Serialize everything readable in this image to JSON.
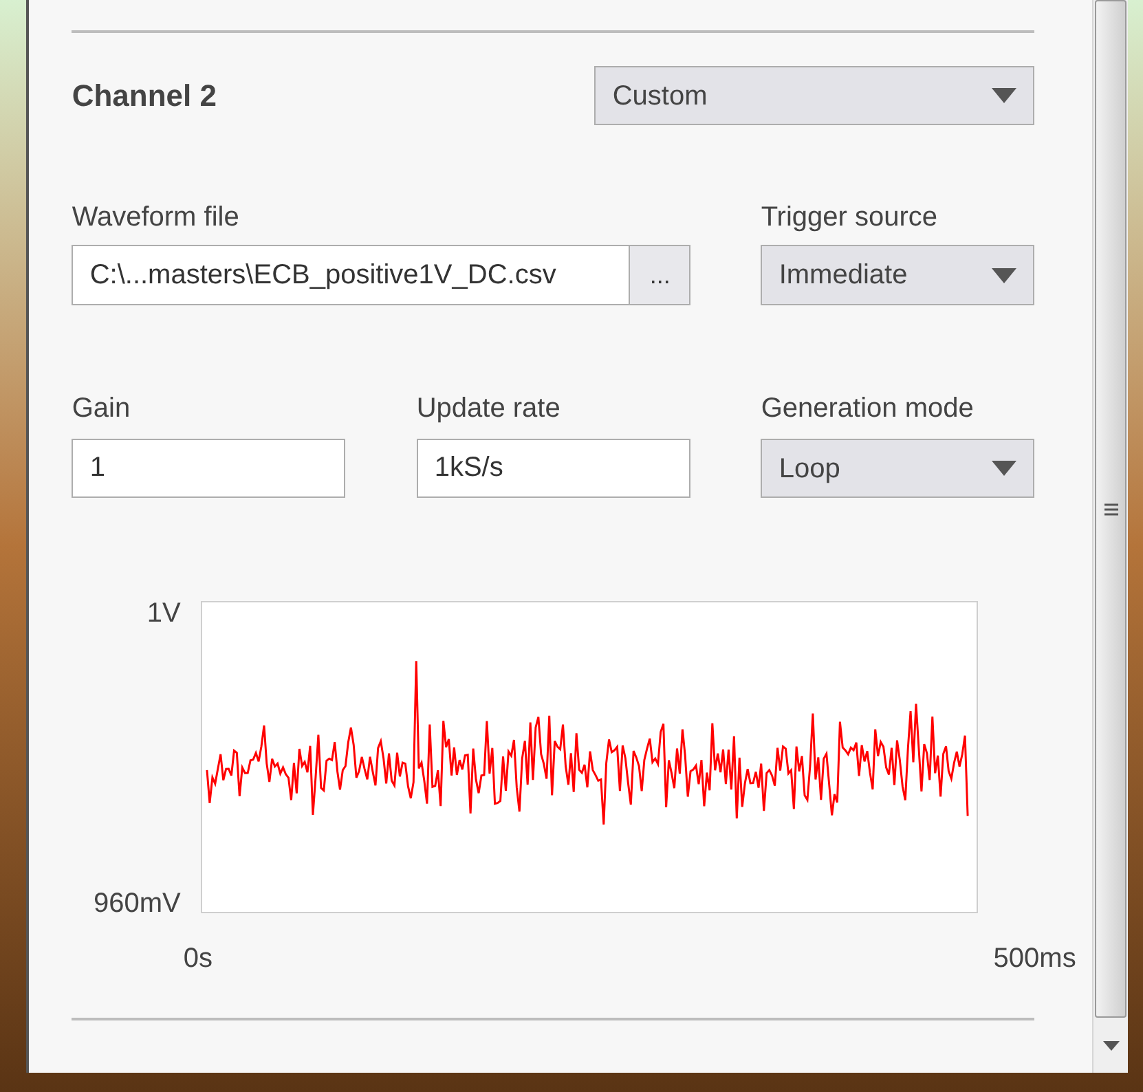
{
  "channel": {
    "title": "Channel 2",
    "preset": "Custom"
  },
  "waveform_file": {
    "label": "Waveform file",
    "value": "C:\\...masters\\ECB_positive1V_DC.csv",
    "browse_button": "..."
  },
  "trigger_source": {
    "label": "Trigger source",
    "value": "Immediate"
  },
  "gain": {
    "label": "Gain",
    "value": "1"
  },
  "update_rate": {
    "label": "Update rate",
    "value": "1kS/s"
  },
  "generation_mode": {
    "label": "Generation mode",
    "value": "Loop"
  },
  "waveform_plot": {
    "y_max_label": "1V",
    "y_min_label": "960mV",
    "x_start_label": "0s",
    "x_end_label": "500ms"
  }
}
